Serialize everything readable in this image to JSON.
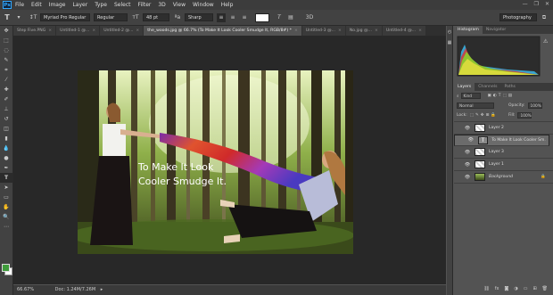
{
  "app": {
    "logo_text": "Ps"
  },
  "menu": [
    "File",
    "Edit",
    "Image",
    "Layer",
    "Type",
    "Select",
    "Filter",
    "3D",
    "View",
    "Window",
    "Help"
  ],
  "options_bar": {
    "font_family": "Myriad Pro Regular",
    "font_style": "Regular",
    "font_size": "48 pt",
    "antialias": "Sharp",
    "workspace": "Photography"
  },
  "tabs": [
    {
      "label": "Step Five.PNG",
      "active": false
    },
    {
      "label": "Untitled-1 @...",
      "active": false
    },
    {
      "label": "Untitled-2 @...",
      "active": false
    },
    {
      "label": "the_woods.jpg @ 66.7% (To Make It Look Cooler Smudge It, RGB/8#) *",
      "active": true
    },
    {
      "label": "Untitled-3 @...",
      "active": false
    },
    {
      "label": "No.jpg @...",
      "active": false
    },
    {
      "label": "Untitled-4 @...",
      "active": false
    }
  ],
  "canvas": {
    "text_line1": "To Make It Look",
    "text_line2": "Cooler Smudge It."
  },
  "status": {
    "zoom": "66.67%",
    "doc": "Doc: 1.24M/7.26M"
  },
  "histogram_panel": {
    "tabs": [
      "Histogram",
      "Navigator"
    ]
  },
  "layers_panel": {
    "tabs": [
      "Layers",
      "Channels",
      "Paths"
    ],
    "filter": "Kind",
    "blend_mode": "Normal",
    "opacity_label": "Opacity:",
    "opacity": "100%",
    "lock_label": "Lock:",
    "fill_label": "Fill:",
    "fill": "100%",
    "layers": [
      {
        "name": "Layer 2",
        "type": "image",
        "selected": false
      },
      {
        "name": "To Make It Look Cooler Sm...",
        "type": "text",
        "selected": true
      },
      {
        "name": "Layer 3",
        "type": "image",
        "selected": false
      },
      {
        "name": "Layer 1",
        "type": "image",
        "selected": false
      },
      {
        "name": "Background",
        "type": "background",
        "selected": false
      }
    ]
  },
  "colors": {
    "foreground": "#3e9b3a",
    "background": "#ffffff",
    "accent": "#31a8ff"
  }
}
